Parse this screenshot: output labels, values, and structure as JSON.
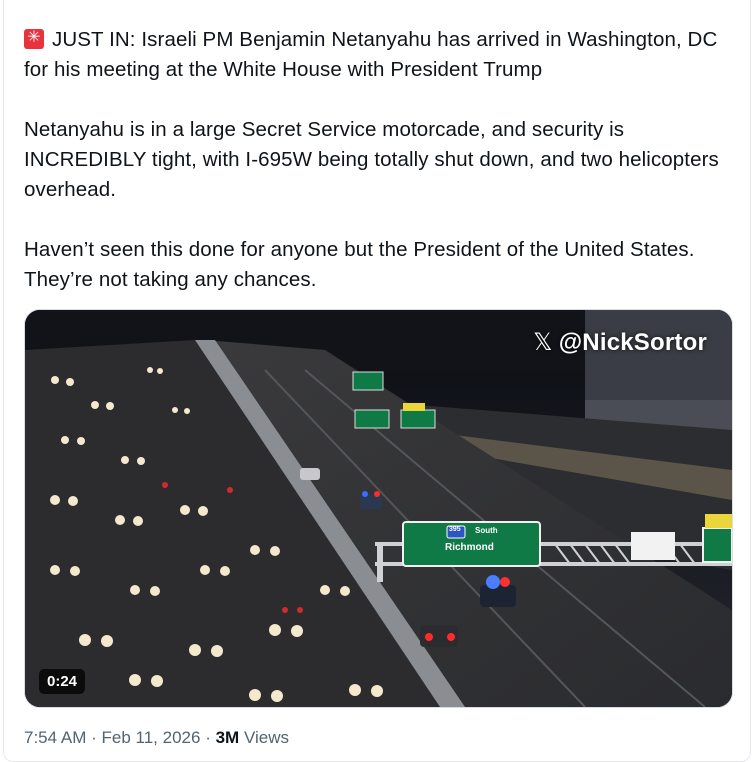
{
  "tweet": {
    "paragraphs": [
      "JUST IN: Israeli PM Benjamin Netanyahu has arrived in Washington, DC for his meeting at the White House with President Trump",
      "Netanyahu is in a large Secret Service motorcade, and security is INCREDIBLY tight, with I-695W being totally shut down, and two helicopters overhead.",
      "Haven’t seen this done for anyone but the President of the United States. They’re not taking any chances."
    ],
    "lead_icon": "rotating-light-icon"
  },
  "media": {
    "watermark": "@NickSortor",
    "watermark_icon": "x-logo-icon",
    "duration": "0:24",
    "sign_text_1": "South",
    "sign_text_2": "Richmond",
    "route_shield": "395"
  },
  "meta": {
    "time": "7:54 AM",
    "date": "Feb 11, 2026",
    "separator": "·",
    "views_count": "3M",
    "views_label": "Views"
  },
  "colors": {
    "text": "#0f1419",
    "secondary": "#536471",
    "sign_green": "#0f7a46",
    "siren_red": "#e8333d"
  }
}
